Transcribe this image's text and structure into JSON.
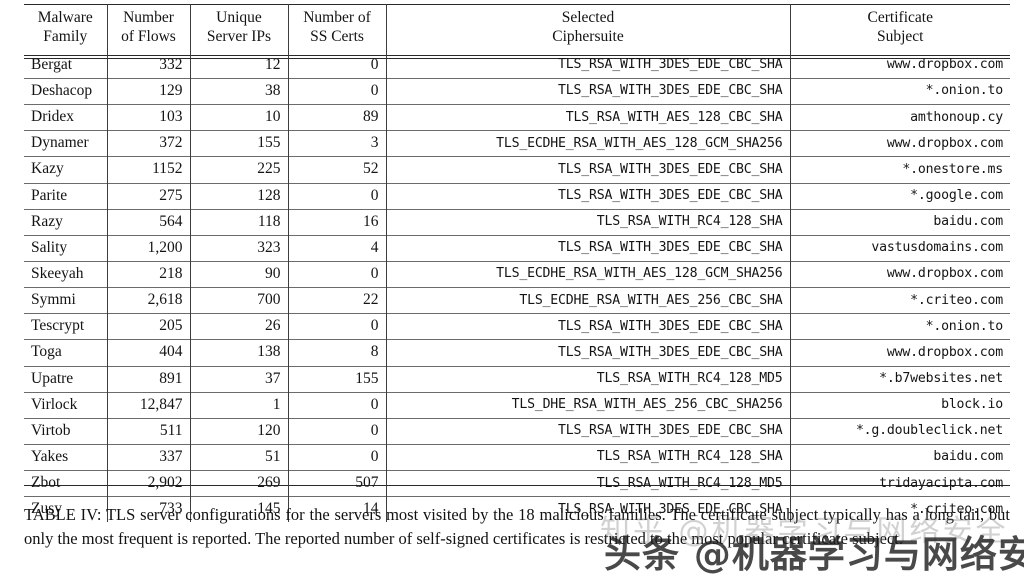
{
  "table": {
    "columns": [
      {
        "key": "family",
        "line1": "Malware",
        "line2": "Family"
      },
      {
        "key": "flows",
        "line1": "Number",
        "line2": "of Flows"
      },
      {
        "key": "ips",
        "line1": "Unique",
        "line2": "Server IPs"
      },
      {
        "key": "certs",
        "line1": "Number of",
        "line2": "SS Certs"
      },
      {
        "key": "cipher",
        "line1": "Selected",
        "line2": "Ciphersuite"
      },
      {
        "key": "subject",
        "line1": "Certificate",
        "line2": "Subject"
      }
    ],
    "rows": [
      {
        "family": "Bergat",
        "flows": "332",
        "ips": "12",
        "certs": "0",
        "cipher": "TLS_RSA_WITH_3DES_EDE_CBC_SHA",
        "subject": "www.dropbox.com"
      },
      {
        "family": "Deshacop",
        "flows": "129",
        "ips": "38",
        "certs": "0",
        "cipher": "TLS_RSA_WITH_3DES_EDE_CBC_SHA",
        "subject": "*.onion.to"
      },
      {
        "family": "Dridex",
        "flows": "103",
        "ips": "10",
        "certs": "89",
        "cipher": "TLS_RSA_WITH_AES_128_CBC_SHA",
        "subject": "amthonoup.cy"
      },
      {
        "family": "Dynamer",
        "flows": "372",
        "ips": "155",
        "certs": "3",
        "cipher": "TLS_ECDHE_RSA_WITH_AES_128_GCM_SHA256",
        "subject": "www.dropbox.com"
      },
      {
        "family": "Kazy",
        "flows": "1152",
        "ips": "225",
        "certs": "52",
        "cipher": "TLS_RSA_WITH_3DES_EDE_CBC_SHA",
        "subject": "*.onestore.ms"
      },
      {
        "family": "Parite",
        "flows": "275",
        "ips": "128",
        "certs": "0",
        "cipher": "TLS_RSA_WITH_3DES_EDE_CBC_SHA",
        "subject": "*.google.com"
      },
      {
        "family": "Razy",
        "flows": "564",
        "ips": "118",
        "certs": "16",
        "cipher": "TLS_RSA_WITH_RC4_128_SHA",
        "subject": "baidu.com"
      },
      {
        "family": "Sality",
        "flows": "1,200",
        "ips": "323",
        "certs": "4",
        "cipher": "TLS_RSA_WITH_3DES_EDE_CBC_SHA",
        "subject": "vastusdomains.com"
      },
      {
        "family": "Skeeyah",
        "flows": "218",
        "ips": "90",
        "certs": "0",
        "cipher": "TLS_ECDHE_RSA_WITH_AES_128_GCM_SHA256",
        "subject": "www.dropbox.com"
      },
      {
        "family": "Symmi",
        "flows": "2,618",
        "ips": "700",
        "certs": "22",
        "cipher": "TLS_ECDHE_RSA_WITH_AES_256_CBC_SHA",
        "subject": "*.criteo.com"
      },
      {
        "family": "Tescrypt",
        "flows": "205",
        "ips": "26",
        "certs": "0",
        "cipher": "TLS_RSA_WITH_3DES_EDE_CBC_SHA",
        "subject": "*.onion.to"
      },
      {
        "family": "Toga",
        "flows": "404",
        "ips": "138",
        "certs": "8",
        "cipher": "TLS_RSA_WITH_3DES_EDE_CBC_SHA",
        "subject": "www.dropbox.com"
      },
      {
        "family": "Upatre",
        "flows": "891",
        "ips": "37",
        "certs": "155",
        "cipher": "TLS_RSA_WITH_RC4_128_MD5",
        "subject": "*.b7websites.net"
      },
      {
        "family": "Virlock",
        "flows": "12,847",
        "ips": "1",
        "certs": "0",
        "cipher": "TLS_DHE_RSA_WITH_AES_256_CBC_SHA256",
        "subject": "block.io"
      },
      {
        "family": "Virtob",
        "flows": "511",
        "ips": "120",
        "certs": "0",
        "cipher": "TLS_RSA_WITH_3DES_EDE_CBC_SHA",
        "subject": "*.g.doubleclick.net"
      },
      {
        "family": "Yakes",
        "flows": "337",
        "ips": "51",
        "certs": "0",
        "cipher": "TLS_RSA_WITH_RC4_128_SHA",
        "subject": "baidu.com"
      },
      {
        "family": "Zbot",
        "flows": "2,902",
        "ips": "269",
        "certs": "507",
        "cipher": "TLS_RSA_WITH_RC4_128_MD5",
        "subject": "tridayacipta.com"
      },
      {
        "family": "Zusy",
        "flows": "733",
        "ips": "145",
        "certs": "14",
        "cipher": "TLS_RSA_WITH_3DES_EDE_CBC_SHA",
        "subject": "*.criteo.com"
      }
    ]
  },
  "caption": {
    "text": "TABLE IV: TLS server configurations for the servers most visited by the 18 malicious families. The certificate subject typically has a long tail, but only the most frequent is reported. The reported number of self-signed certificates is restricted to the most popular certificate subject."
  },
  "watermarks": {
    "zhihu": "知乎 @机器学习与网络安全",
    "toutiao": "头条 @机器学习与网络安全"
  }
}
